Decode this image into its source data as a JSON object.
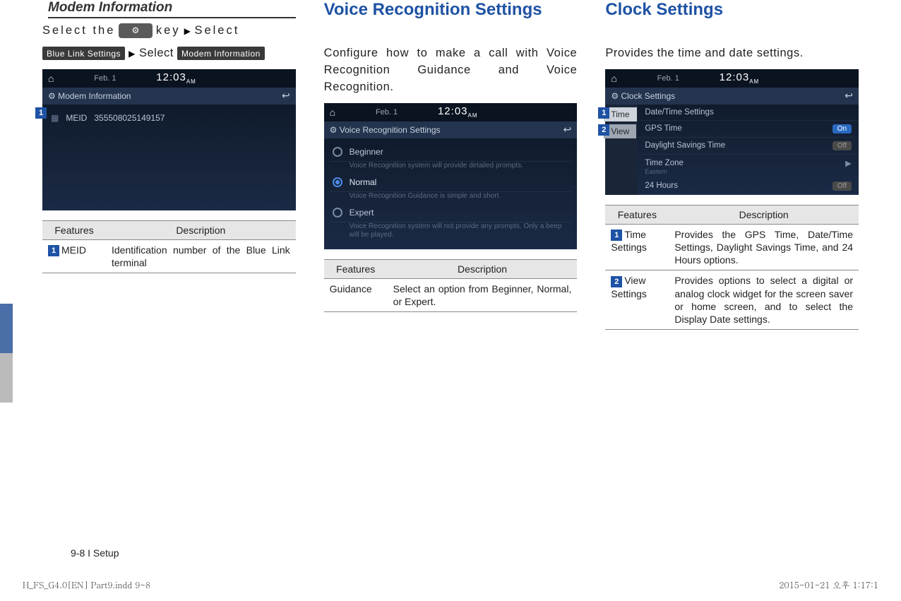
{
  "col1": {
    "heading": "Modem Information",
    "instr_prefix": "Select the",
    "instr_key_word": "key",
    "instr_select": "Select",
    "btn1": "Blue Link Settings",
    "btn2": "Modem Information",
    "key_icon_label": "⚙",
    "screenshot": {
      "date": "Feb.   1",
      "time": "12:03",
      "ampm": "AM",
      "subbar_title": "Modem Information",
      "meid_label": "MEID",
      "meid_value": "355508025149157",
      "badge": "1"
    },
    "table": {
      "h1": "Features",
      "h2": "Description",
      "rows": [
        {
          "badge": "1",
          "feature": "MEID",
          "desc": "Identification number of the Blue Link terminal"
        }
      ]
    }
  },
  "col2": {
    "heading": "Voice Recognition Settings",
    "intro": "Configure how to make a call with Voice Recognition Guidance and Voice Recognition.",
    "screenshot": {
      "date": "Feb.   1",
      "time": "12:03",
      "ampm": "AM",
      "subbar_title": "Voice Recognition Settings",
      "opt1": "Beginner",
      "opt1_hint": "Voice Recognition system will provide detailed prompts.",
      "opt2": "Normal",
      "opt2_hint": "Voice Recognition Guidance is simple and short.",
      "opt3": "Expert",
      "opt3_hint": "Voice Recognition system will not provide any prompts. Only a beep will be played."
    },
    "table": {
      "h1": "Features",
      "h2": "Description",
      "rows": [
        {
          "feature": "Guidance",
          "desc": "Select an option from Beginner, Normal, or Expert."
        }
      ]
    }
  },
  "col3": {
    "heading": "Clock Settings",
    "intro": "Provides the time and date settings.",
    "screenshot": {
      "date": "Feb.   1",
      "time": "12:03",
      "ampm": "AM",
      "subbar_title": "Clock Settings",
      "tab1": "Time",
      "tab1_badge": "1",
      "tab2": "View",
      "tab2_badge": "2",
      "row1": "Date/Time Settings",
      "row2": "GPS Time",
      "row2_toggle": "On",
      "row3": "Daylight Savings Time",
      "row3_toggle": "Off",
      "row4": "Time Zone",
      "row4_sub": "Eastern",
      "row5": "24 Hours",
      "row5_toggle": "Off"
    },
    "table": {
      "h1": "Features",
      "h2": "Description",
      "rows": [
        {
          "badge": "1",
          "feature": "Time Settings",
          "desc": "Provides the GPS Time, Date/Time Settings, Daylight Savings Time, and 24 Hours options."
        },
        {
          "badge": "2",
          "feature": "View Settings",
          "desc": "Provides options to select a digital or analog clock widget for the screen saver or home screen, and to select the Display Date settings."
        }
      ]
    }
  },
  "footer": "9-8 I Setup",
  "print_left": "H_FS_G4.0[EN] Part9.indd   9-8",
  "print_right": "2015-01-21   오후 1:17:1"
}
